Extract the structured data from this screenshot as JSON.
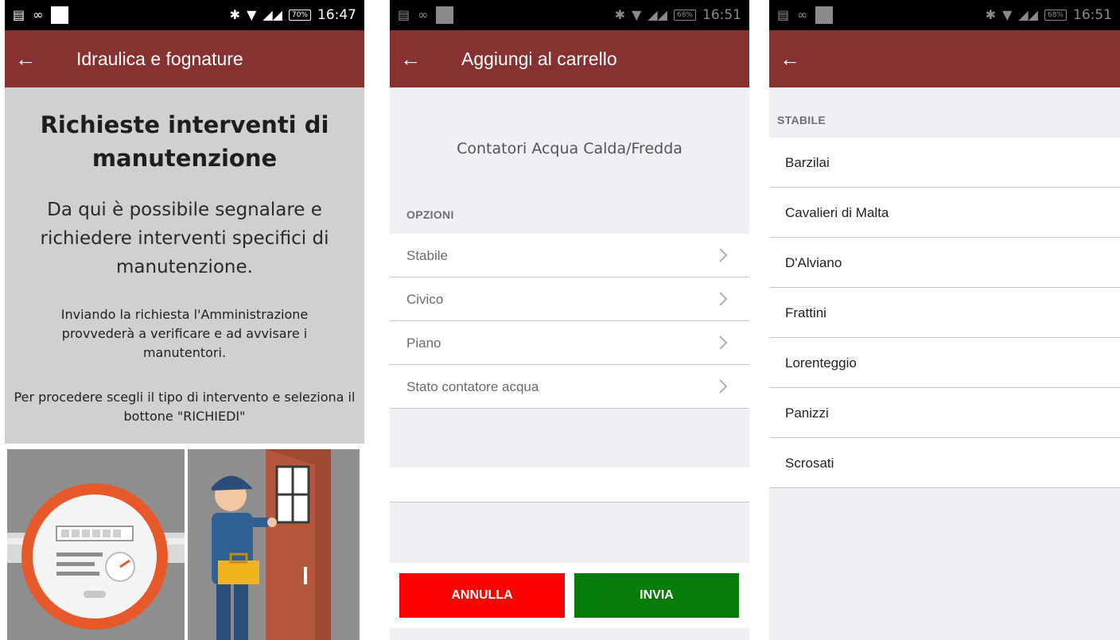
{
  "colors": {
    "appbar": "#873130",
    "cancel_button": "#fe0000",
    "send_button": "#087c0b"
  },
  "screen1": {
    "status": {
      "time": "16:47",
      "battery": "70%"
    },
    "title": "Idraulica e fognature",
    "heading": "Richieste interventi di manutenzione",
    "lead": "Da qui è possibile segnalare e richiedere interventi specifici di manutenzione.",
    "paragraph1": "Inviando la richiesta l'Amministrazione provvederà a verificare e ad avvisare i manutentori.",
    "paragraph2": "Per procedere scegli il tipo di intervento e seleziona il bottone \"RICHIEDI\""
  },
  "screen2": {
    "status": {
      "time": "16:51",
      "battery": "68%"
    },
    "title": "Aggiungi al carrello",
    "product_name": "Contatori Acqua Calda/Fredda",
    "options_header": "OPZIONI",
    "options": [
      {
        "label": "Stabile"
      },
      {
        "label": "Civico"
      },
      {
        "label": "Piano"
      },
      {
        "label": "Stato contatore acqua"
      }
    ],
    "cancel_label": "ANNULLA",
    "send_label": "INVIA"
  },
  "screen3": {
    "status": {
      "time": "16:51",
      "battery": "68%"
    },
    "section_header": "STABILE",
    "items": [
      {
        "label": "Barzilai"
      },
      {
        "label": "Cavalieri di Malta"
      },
      {
        "label": "D'Alviano"
      },
      {
        "label": "Frattini"
      },
      {
        "label": "Lorenteggio"
      },
      {
        "label": "Panizzi"
      },
      {
        "label": "Scrosati"
      }
    ]
  }
}
